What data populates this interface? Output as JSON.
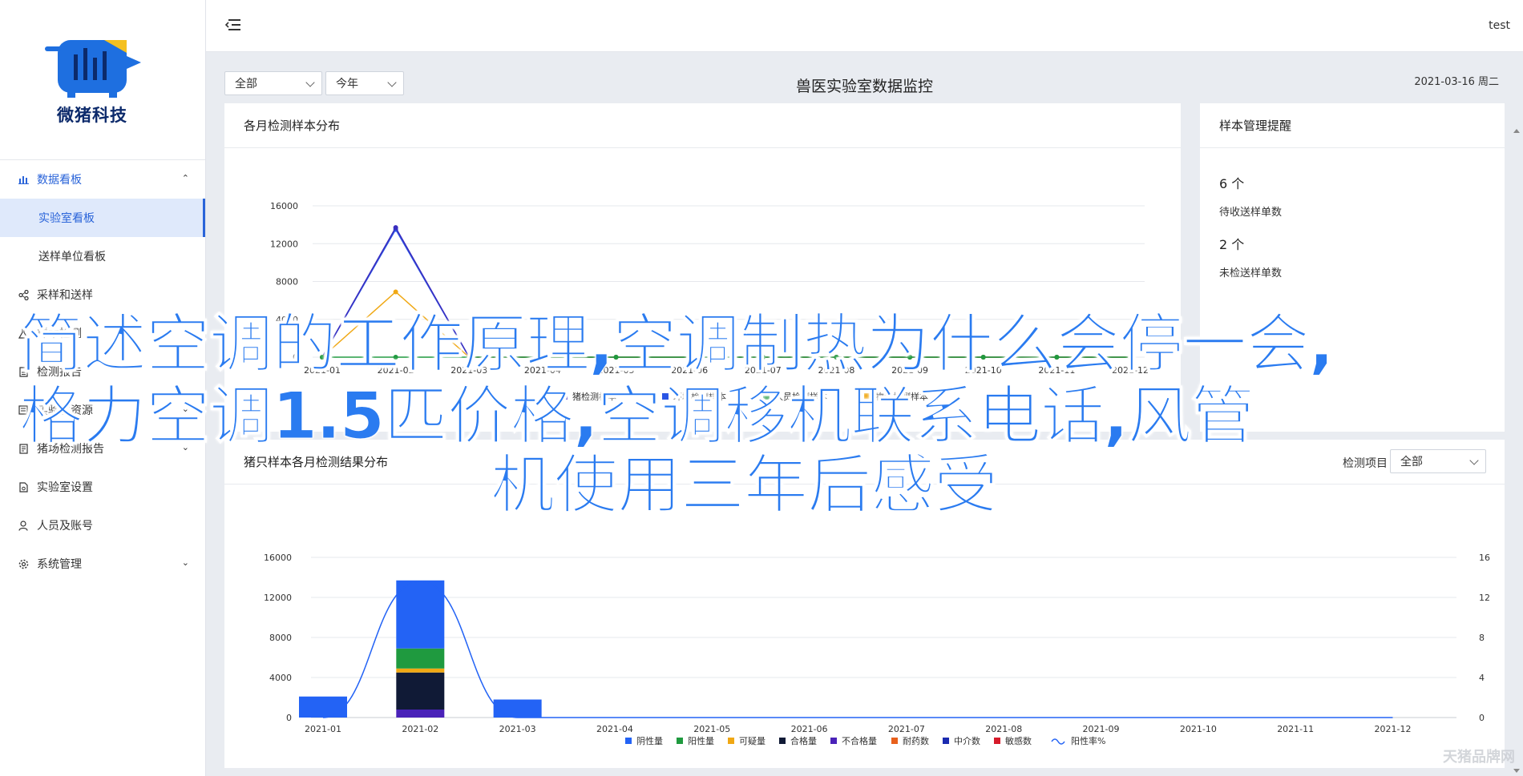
{
  "brand": {
    "name": "微猪科技"
  },
  "topbar": {
    "user": "test"
  },
  "sidebar": {
    "items": [
      {
        "label": "数据看板",
        "icon": "bar-chart-icon",
        "expanded": true
      },
      {
        "label": "实验室看板",
        "active": true
      },
      {
        "label": "送样单位看板"
      },
      {
        "label": "采样和送样",
        "icon": "share-icon"
      },
      {
        "label": "样本检测",
        "icon": "flask-icon"
      },
      {
        "label": "检测报告",
        "icon": "document-icon"
      },
      {
        "label": "实验室资源",
        "icon": "folder-icon"
      },
      {
        "label": "猪场检测报告",
        "icon": "report-icon"
      },
      {
        "label": "实验室设置",
        "icon": "settings-doc-icon"
      },
      {
        "label": "人员及账号",
        "icon": "user-icon"
      },
      {
        "label": "系统管理",
        "icon": "gear-icon"
      }
    ]
  },
  "filters": {
    "scope": "全部",
    "period": "今年"
  },
  "page": {
    "title": "兽医实验室数据监控",
    "date": "2021-03-16 周二"
  },
  "cards": {
    "monthly": {
      "title": "各月检测样本分布"
    },
    "reminder": {
      "title": "样本管理提醒",
      "items": [
        {
          "count": "6 个",
          "label": "待收送样单数"
        },
        {
          "count": "2 个",
          "label": "未检送样单数"
        }
      ]
    },
    "pig": {
      "title": "猪只样本各月检测结果分布",
      "control_label": "检测项目",
      "control_value": "全部"
    }
  },
  "overlay": {
    "line1": "简述空调的工作原理,空调制热为什么会停一会,",
    "line2": "格力空调1.5匹价格,空调移机联系电话,风管",
    "line3": "机使用三年后感受"
  },
  "watermark": "天猪品牌网",
  "chart_data": [
    {
      "type": "line",
      "title": "各月检测样本分布",
      "categories": [
        "2021-01",
        "2021-02",
        "2021-03",
        "2021-04",
        "2021-05",
        "2021-06",
        "2021-07",
        "2021-08",
        "2021-09",
        "2021-10",
        "2021-11",
        "2021-12"
      ],
      "y_ticks": [
        "0",
        "4000",
        "8000",
        "12000",
        "16000"
      ],
      "ylim": [
        0,
        16000
      ],
      "series": [
        {
          "color": "#2a55e5",
          "values": [
            0,
            13500,
            0,
            0,
            0,
            0,
            0,
            0,
            0,
            0,
            0,
            0
          ]
        },
        {
          "color": "#3a2dbf",
          "values": [
            0,
            13700,
            0,
            0,
            0,
            0,
            0,
            0,
            0,
            0,
            0,
            0
          ]
        },
        {
          "color": "#f0a814",
          "values": [
            0,
            6900,
            0,
            0,
            0,
            0,
            0,
            0,
            0,
            0,
            0,
            0
          ]
        },
        {
          "color": "#1f9a3f",
          "values": [
            0,
            0,
            0,
            0,
            0,
            0,
            0,
            0,
            0,
            0,
            0,
            0
          ]
        }
      ],
      "legend": [
        "猪检测样本",
        "环境检测样本",
        "人员检测样本",
        "物资检测样本"
      ],
      "legend_colors": [
        "#3a2dbf",
        "#2a55e5",
        "#1f9a3f",
        "#f0a814"
      ]
    },
    {
      "type": "bar",
      "title": "猪只样本各月检测结果分布",
      "categories": [
        "2021-01",
        "2021-02",
        "2021-03",
        "2021-04",
        "2021-05",
        "2021-06",
        "2021-07",
        "2021-08",
        "2021-09",
        "2021-10",
        "2021-11",
        "2021-12"
      ],
      "y_ticks": [
        "0",
        "4000",
        "8000",
        "12000",
        "16000"
      ],
      "ylim": [
        0,
        16000
      ],
      "y2_ticks": [
        "0",
        "4",
        "8",
        "12",
        "16"
      ],
      "y2lim": [
        0,
        16
      ],
      "series": [
        {
          "name": "阴性量",
          "color": "#2363f5",
          "values": [
            2100,
            6800,
            1800,
            0,
            0,
            0,
            0,
            0,
            0,
            0,
            0,
            0
          ]
        },
        {
          "name": "阳性量",
          "color": "#1f9a3f",
          "values": [
            0,
            2000,
            0,
            0,
            0,
            0,
            0,
            0,
            0,
            0,
            0,
            0
          ]
        },
        {
          "name": "可疑量",
          "color": "#f0a814",
          "values": [
            0,
            400,
            0,
            0,
            0,
            0,
            0,
            0,
            0,
            0,
            0,
            0
          ]
        },
        {
          "name": "合格量",
          "color": "#101a36",
          "values": [
            0,
            3700,
            0,
            0,
            0,
            0,
            0,
            0,
            0,
            0,
            0,
            0
          ]
        },
        {
          "name": "不合格量",
          "color": "#4a22b8",
          "values": [
            0,
            800,
            0,
            0,
            0,
            0,
            0,
            0,
            0,
            0,
            0,
            0
          ]
        },
        {
          "name": "耐药数",
          "color": "#e8601c",
          "values": [
            0,
            0,
            0,
            0,
            0,
            0,
            0,
            0,
            0,
            0,
            0,
            0
          ]
        },
        {
          "name": "中介数",
          "color": "#1b2bb0",
          "values": [
            0,
            0,
            0,
            0,
            0,
            0,
            0,
            0,
            0,
            0,
            0,
            0
          ]
        },
        {
          "name": "敏感数",
          "color": "#d61a2a",
          "values": [
            0,
            0,
            0,
            0,
            0,
            0,
            0,
            0,
            0,
            0,
            0,
            0
          ]
        }
      ],
      "line": {
        "name": "阳性率%",
        "color": "#2363f5",
        "values": [
          0,
          13.6,
          0,
          0,
          0,
          0,
          0,
          0,
          0,
          0,
          0,
          0
        ]
      }
    }
  ]
}
